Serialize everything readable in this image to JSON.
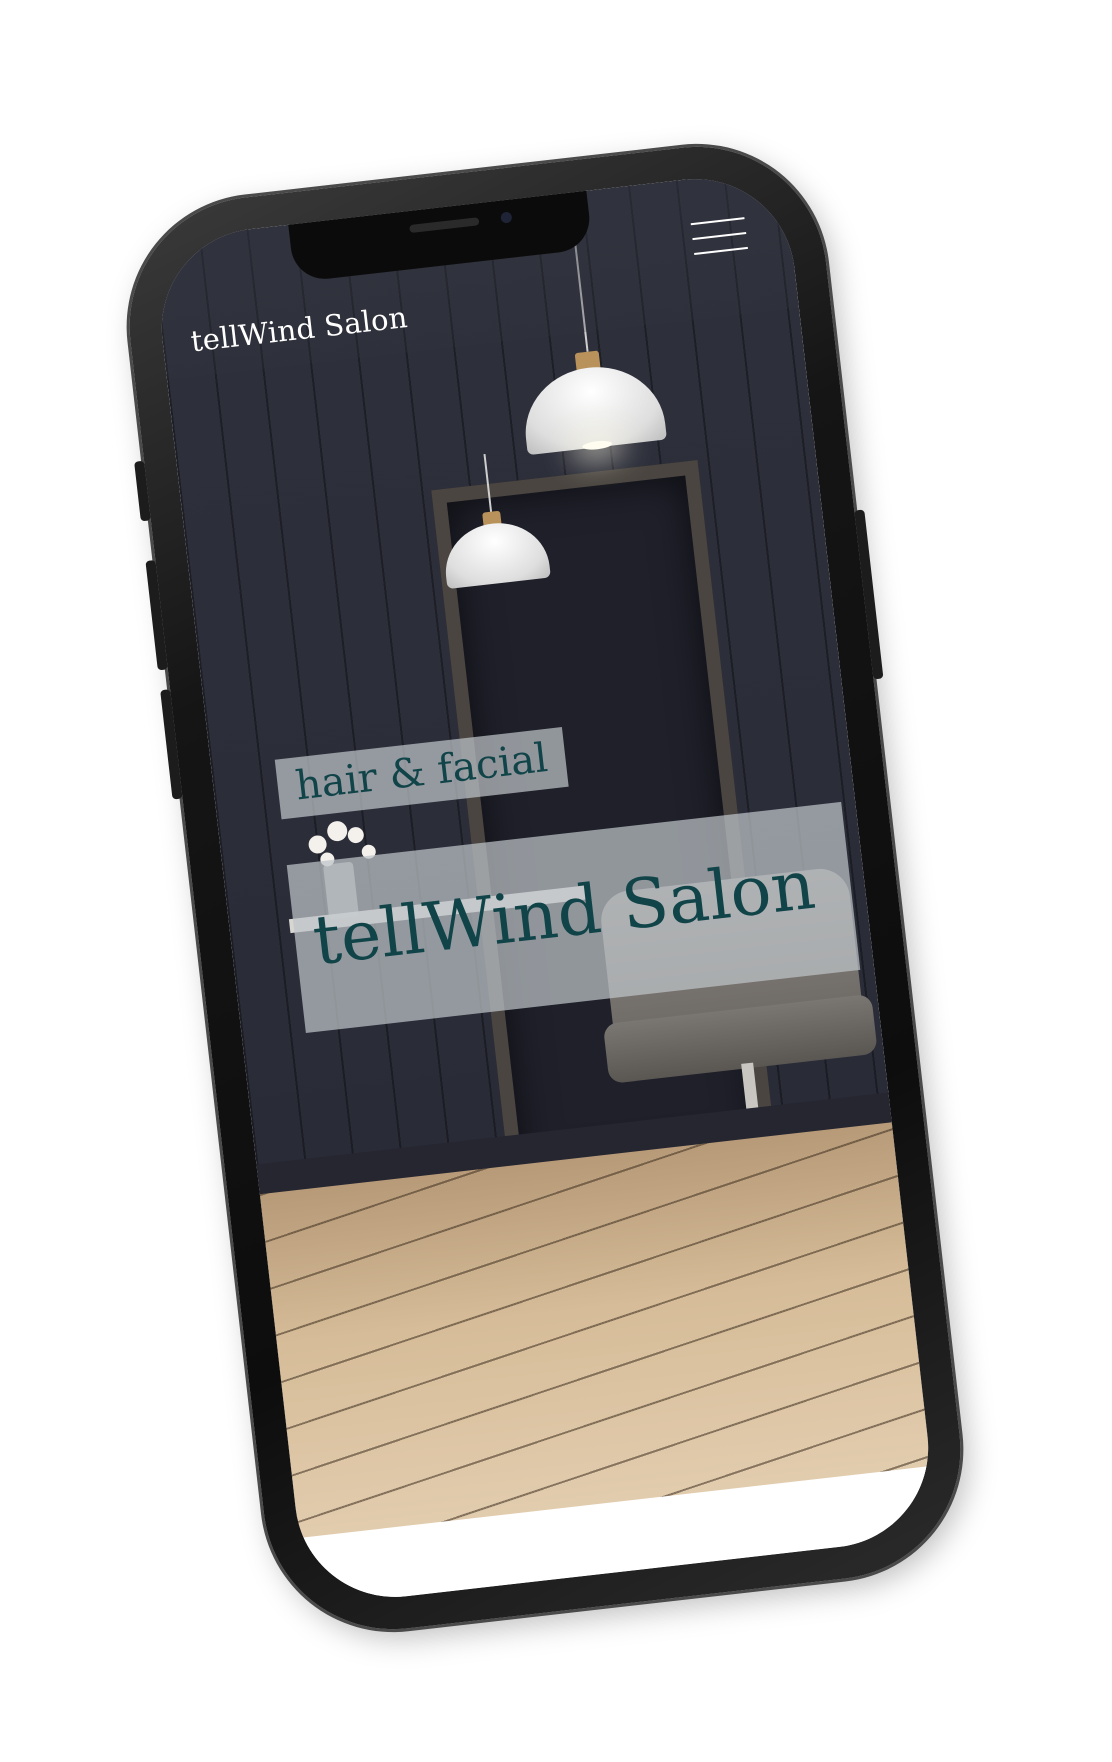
{
  "header": {
    "brand": "tellWind Salon",
    "menu_icon": "hamburger-menu-icon"
  },
  "hero": {
    "tagline": "hair & facial",
    "title": "tellWind Salon"
  },
  "colors": {
    "accent_text": "#104448",
    "overlay_box": "#bec4c8",
    "wall": "#2e303c",
    "floor": "#d6bc98"
  }
}
